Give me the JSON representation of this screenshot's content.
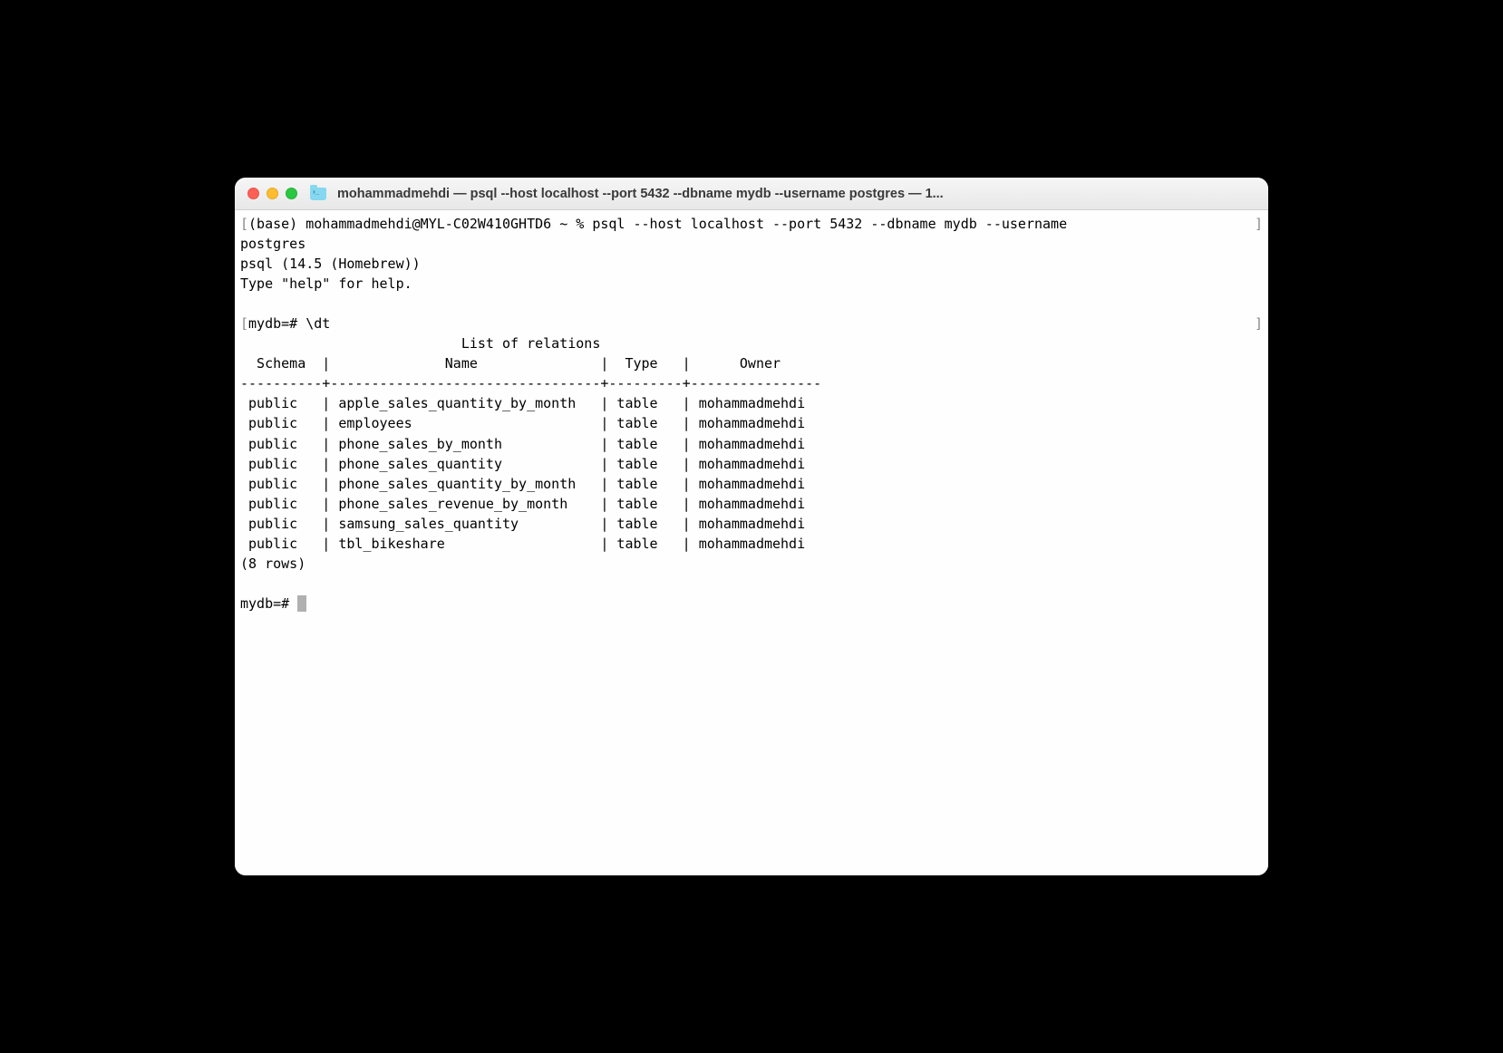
{
  "window": {
    "title": "mohammadmehdi — psql --host localhost --port 5432 --dbname mydb --username postgres — 1..."
  },
  "terminal": {
    "shell_prompt": "(base) mohammadmehdi@MYL-C02W410GHTD6 ~ % ",
    "command": "psql --host localhost --port 5432 --dbname mydb --username ",
    "command_cont": "postgres",
    "version_line": "psql (14.5 (Homebrew))",
    "help_line": "Type \"help\" for help.",
    "db_prompt": "mydb=# ",
    "dt_command": "\\dt",
    "table_title": "List of relations",
    "headers": {
      "schema": "Schema",
      "name": "Name",
      "type": "Type",
      "owner": "Owner"
    },
    "rows": [
      {
        "schema": "public",
        "name": "apple_sales_quantity_by_month",
        "type": "table",
        "owner": "mohammadmehdi"
      },
      {
        "schema": "public",
        "name": "employees",
        "type": "table",
        "owner": "mohammadmehdi"
      },
      {
        "schema": "public",
        "name": "phone_sales_by_month",
        "type": "table",
        "owner": "mohammadmehdi"
      },
      {
        "schema": "public",
        "name": "phone_sales_quantity",
        "type": "table",
        "owner": "mohammadmehdi"
      },
      {
        "schema": "public",
        "name": "phone_sales_quantity_by_month",
        "type": "table",
        "owner": "mohammadmehdi"
      },
      {
        "schema": "public",
        "name": "phone_sales_revenue_by_month",
        "type": "table",
        "owner": "mohammadmehdi"
      },
      {
        "schema": "public",
        "name": "samsung_sales_quantity",
        "type": "table",
        "owner": "mohammadmehdi"
      },
      {
        "schema": "public",
        "name": "tbl_bikeshare",
        "type": "table",
        "owner": "mohammadmehdi"
      }
    ],
    "row_count": "(8 rows)",
    "final_prompt": "mydb=# "
  },
  "layout": {
    "col_widths": {
      "schema": 8,
      "name": 31,
      "type": 7,
      "owner": 15
    }
  }
}
